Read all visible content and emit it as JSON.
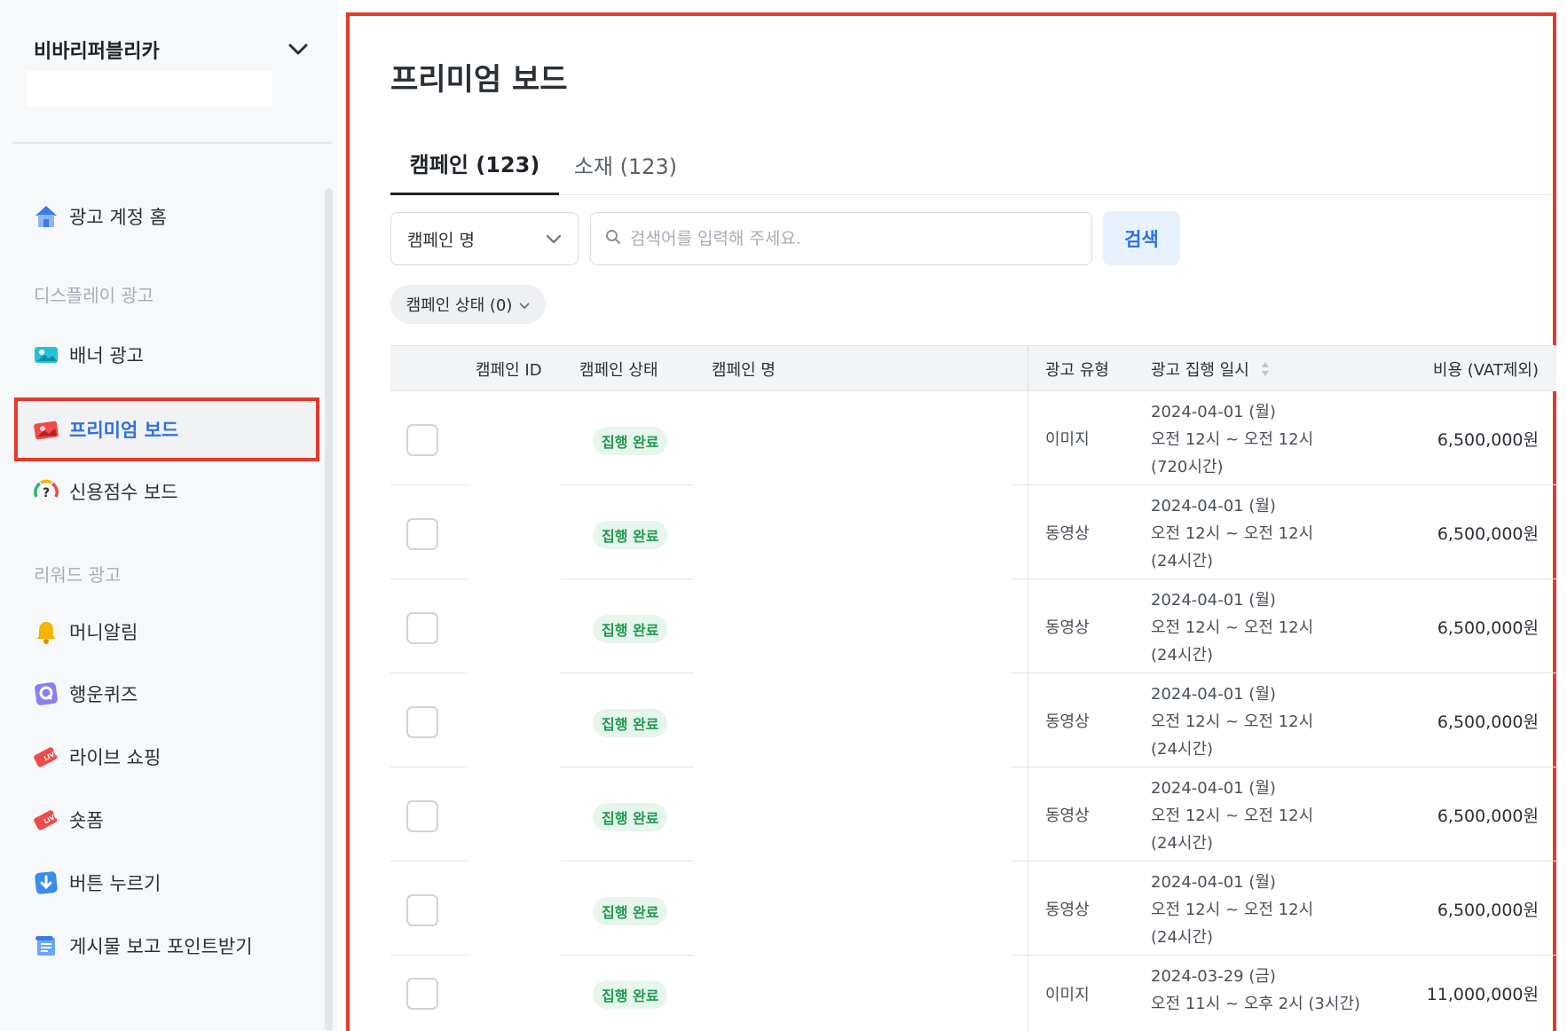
{
  "sidebar": {
    "account_name": "비바리퍼블리카",
    "items": [
      {
        "label": "광고 계정 홈",
        "icon": "house-icon"
      },
      {
        "label": "배너 광고",
        "icon": "banner-image-icon"
      },
      {
        "label": "프리미엄 보드",
        "icon": "premium-board-icon",
        "active": true
      },
      {
        "label": "신용점수 보드",
        "icon": "credit-score-icon"
      },
      {
        "label": "머니알림",
        "icon": "bell-icon"
      },
      {
        "label": "행운퀴즈",
        "icon": "quiz-icon"
      },
      {
        "label": "라이브 쇼핑",
        "icon": "live-ticket-icon"
      },
      {
        "label": "숏폼",
        "icon": "live-ticket-icon"
      },
      {
        "label": "버튼 누르기",
        "icon": "download-button-icon"
      },
      {
        "label": "게시물 보고 포인트받기",
        "icon": "scroll-icon"
      }
    ],
    "sections": [
      "디스플레이 광고",
      "리워드 광고"
    ]
  },
  "page": {
    "title": "프리미엄 보드",
    "tabs": [
      {
        "label": "캠페인 (123)",
        "active": true
      },
      {
        "label": "소재 (123)",
        "active": false
      }
    ]
  },
  "filters": {
    "select_value": "캠페인 명",
    "search_placeholder": "검색어를 입력해 주세요.",
    "search_button": "검색",
    "status_chip": "캠페인 상태 (0)"
  },
  "table": {
    "headers": {
      "campaign_id": "캠페인 ID",
      "campaign_status": "캠페인 상태",
      "campaign_name": "캠페인 명",
      "ad_type": "광고 유형",
      "ad_period": "광고 집행 일시",
      "cost": "비용 (VAT제외)"
    },
    "rows": [
      {
        "status": "집행 완료",
        "type": "이미지",
        "date": "2024-04-01 (월)",
        "time": "오전 12시 ~ 오전 12시",
        "duration": "(720시간)",
        "cost": "6,500,000원"
      },
      {
        "status": "집행 완료",
        "type": "동영상",
        "date": "2024-04-01 (월)",
        "time": "오전 12시 ~ 오전 12시",
        "duration": "(24시간)",
        "cost": "6,500,000원"
      },
      {
        "status": "집행 완료",
        "type": "동영상",
        "date": "2024-04-01 (월)",
        "time": "오전 12시 ~ 오전 12시",
        "duration": "(24시간)",
        "cost": "6,500,000원"
      },
      {
        "status": "집행 완료",
        "type": "동영상",
        "date": "2024-04-01 (월)",
        "time": "오전 12시 ~ 오전 12시",
        "duration": "(24시간)",
        "cost": "6,500,000원"
      },
      {
        "status": "집행 완료",
        "type": "동영상",
        "date": "2024-04-01 (월)",
        "time": "오전 12시 ~ 오전 12시",
        "duration": "(24시간)",
        "cost": "6,500,000원"
      },
      {
        "status": "집행 완료",
        "type": "동영상",
        "date": "2024-04-01 (월)",
        "time": "오전 12시 ~ 오전 12시",
        "duration": "(24시간)",
        "cost": "6,500,000원"
      },
      {
        "status": "집행 완료",
        "type": "이미지",
        "date": "2024-03-29 (금)",
        "time": "오전 11시 ~ 오후 2시 (3시간)",
        "duration": "",
        "cost": "11,000,000원"
      }
    ]
  },
  "colors": {
    "highlight_border": "#e53a2c",
    "active_link": "#2f6fe4",
    "badge_bg": "#e7f6ec",
    "badge_text": "#1e9a4f",
    "search_button_bg": "#e8f2fd"
  }
}
